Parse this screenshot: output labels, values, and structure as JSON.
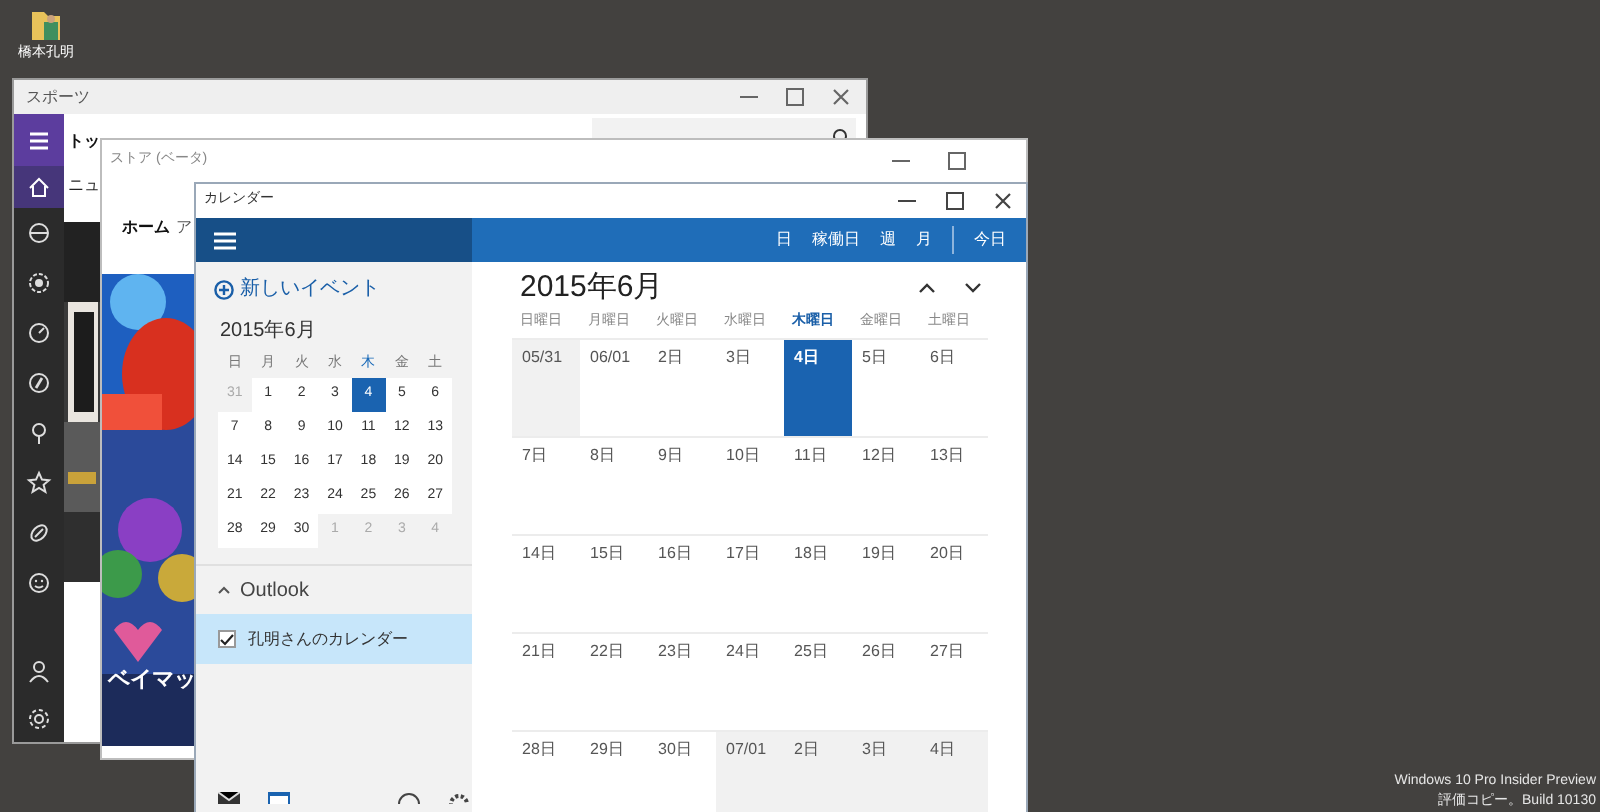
{
  "desktop": {
    "icons": [
      {
        "label": "橋本孔明"
      }
    ],
    "watermark": [
      "Windows 10 Pro Insider Preview",
      "評価コピー。Build 10130"
    ]
  },
  "sports_window": {
    "title": "スポーツ",
    "heading": "トッ",
    "subheading": "ニュ",
    "nav_items": [
      {
        "selected": true
      },
      {
        "selected": false
      },
      {
        "selected": false
      },
      {
        "selected": false
      },
      {
        "selected": false
      },
      {
        "selected": false
      },
      {
        "selected": false
      },
      {
        "selected": false
      },
      {
        "selected": false
      },
      {
        "selected": false
      },
      {
        "selected": false
      }
    ]
  },
  "store_window": {
    "title": "ストア (ベータ)",
    "tabs": [
      {
        "label": "ホーム",
        "selected": true
      },
      {
        "label": "ア",
        "selected": false
      }
    ],
    "banner_caption": "ベイマッ"
  },
  "calendar_window": {
    "title": "カレンダー",
    "new_event": "新しいイベント",
    "mini_month": "2015年6月",
    "mini_weekdays": [
      {
        "label": "日",
        "current": false
      },
      {
        "label": "月",
        "current": false
      },
      {
        "label": "火",
        "current": false
      },
      {
        "label": "水",
        "current": false
      },
      {
        "label": "木",
        "current": true
      },
      {
        "label": "金",
        "current": false
      },
      {
        "label": "土",
        "current": false
      }
    ],
    "mini_days": [
      {
        "day": "31",
        "in_month": false,
        "selected": false
      },
      {
        "day": "1",
        "in_month": true,
        "selected": false
      },
      {
        "day": "2",
        "in_month": true,
        "selected": false
      },
      {
        "day": "3",
        "in_month": true,
        "selected": false
      },
      {
        "day": "4",
        "in_month": true,
        "selected": true
      },
      {
        "day": "5",
        "in_month": true,
        "selected": false
      },
      {
        "day": "6",
        "in_month": true,
        "selected": false
      },
      {
        "day": "7",
        "in_month": true,
        "selected": false
      },
      {
        "day": "8",
        "in_month": true,
        "selected": false
      },
      {
        "day": "9",
        "in_month": true,
        "selected": false
      },
      {
        "day": "10",
        "in_month": true,
        "selected": false
      },
      {
        "day": "11",
        "in_month": true,
        "selected": false
      },
      {
        "day": "12",
        "in_month": true,
        "selected": false
      },
      {
        "day": "13",
        "in_month": true,
        "selected": false
      },
      {
        "day": "14",
        "in_month": true,
        "selected": false
      },
      {
        "day": "15",
        "in_month": true,
        "selected": false
      },
      {
        "day": "16",
        "in_month": true,
        "selected": false
      },
      {
        "day": "17",
        "in_month": true,
        "selected": false
      },
      {
        "day": "18",
        "in_month": true,
        "selected": false
      },
      {
        "day": "19",
        "in_month": true,
        "selected": false
      },
      {
        "day": "20",
        "in_month": true,
        "selected": false
      },
      {
        "day": "21",
        "in_month": true,
        "selected": false
      },
      {
        "day": "22",
        "in_month": true,
        "selected": false
      },
      {
        "day": "23",
        "in_month": true,
        "selected": false
      },
      {
        "day": "24",
        "in_month": true,
        "selected": false
      },
      {
        "day": "25",
        "in_month": true,
        "selected": false
      },
      {
        "day": "26",
        "in_month": true,
        "selected": false
      },
      {
        "day": "27",
        "in_month": true,
        "selected": false
      },
      {
        "day": "28",
        "in_month": true,
        "selected": false
      },
      {
        "day": "29",
        "in_month": true,
        "selected": false
      },
      {
        "day": "30",
        "in_month": true,
        "selected": false
      },
      {
        "day": "1",
        "in_month": false,
        "selected": false
      },
      {
        "day": "2",
        "in_month": false,
        "selected": false
      },
      {
        "day": "3",
        "in_month": false,
        "selected": false
      },
      {
        "day": "4",
        "in_month": false,
        "selected": false
      }
    ],
    "account": {
      "label": "Outlook",
      "expanded": true
    },
    "calendars": [
      {
        "label": "孔明さんのカレンダー",
        "checked": true,
        "selected": true
      }
    ],
    "views": [
      {
        "label": "日",
        "kind": "view"
      },
      {
        "label": "稼働日",
        "kind": "view"
      },
      {
        "label": "週",
        "kind": "view"
      },
      {
        "label": "月",
        "kind": "view"
      },
      {
        "label": "今日",
        "kind": "today"
      }
    ],
    "month_title": "2015年6月",
    "weekdays": [
      {
        "label": "日曜日",
        "current": false
      },
      {
        "label": "月曜日",
        "current": false
      },
      {
        "label": "火曜日",
        "current": false
      },
      {
        "label": "水曜日",
        "current": false
      },
      {
        "label": "木曜日",
        "current": true
      },
      {
        "label": "金曜日",
        "current": false
      },
      {
        "label": "土曜日",
        "current": false
      }
    ],
    "days": [
      {
        "label": "05/31",
        "in_month": false,
        "selected": false
      },
      {
        "label": "06/01",
        "in_month": true,
        "selected": false
      },
      {
        "label": "2日",
        "in_month": true,
        "selected": false
      },
      {
        "label": "3日",
        "in_month": true,
        "selected": false
      },
      {
        "label": "4日",
        "in_month": true,
        "selected": true
      },
      {
        "label": "5日",
        "in_month": true,
        "selected": false
      },
      {
        "label": "6日",
        "in_month": true,
        "selected": false
      },
      {
        "label": "7日",
        "in_month": true,
        "selected": false
      },
      {
        "label": "8日",
        "in_month": true,
        "selected": false
      },
      {
        "label": "9日",
        "in_month": true,
        "selected": false
      },
      {
        "label": "10日",
        "in_month": true,
        "selected": false
      },
      {
        "label": "11日",
        "in_month": true,
        "selected": false
      },
      {
        "label": "12日",
        "in_month": true,
        "selected": false
      },
      {
        "label": "13日",
        "in_month": true,
        "selected": false
      },
      {
        "label": "14日",
        "in_month": true,
        "selected": false
      },
      {
        "label": "15日",
        "in_month": true,
        "selected": false
      },
      {
        "label": "16日",
        "in_month": true,
        "selected": false
      },
      {
        "label": "17日",
        "in_month": true,
        "selected": false
      },
      {
        "label": "18日",
        "in_month": true,
        "selected": false
      },
      {
        "label": "19日",
        "in_month": true,
        "selected": false
      },
      {
        "label": "20日",
        "in_month": true,
        "selected": false
      },
      {
        "label": "21日",
        "in_month": true,
        "selected": false
      },
      {
        "label": "22日",
        "in_month": true,
        "selected": false
      },
      {
        "label": "23日",
        "in_month": true,
        "selected": false
      },
      {
        "label": "24日",
        "in_month": true,
        "selected": false
      },
      {
        "label": "25日",
        "in_month": true,
        "selected": false
      },
      {
        "label": "26日",
        "in_month": true,
        "selected": false
      },
      {
        "label": "27日",
        "in_month": true,
        "selected": false
      },
      {
        "label": "28日",
        "in_month": true,
        "selected": false
      },
      {
        "label": "29日",
        "in_month": true,
        "selected": false
      },
      {
        "label": "30日",
        "in_month": true,
        "selected": false
      },
      {
        "label": "07/01",
        "in_month": false,
        "selected": false
      },
      {
        "label": "2日",
        "in_month": false,
        "selected": false
      },
      {
        "label": "3日",
        "in_month": false,
        "selected": false
      },
      {
        "label": "4日",
        "in_month": false,
        "selected": false
      }
    ]
  }
}
